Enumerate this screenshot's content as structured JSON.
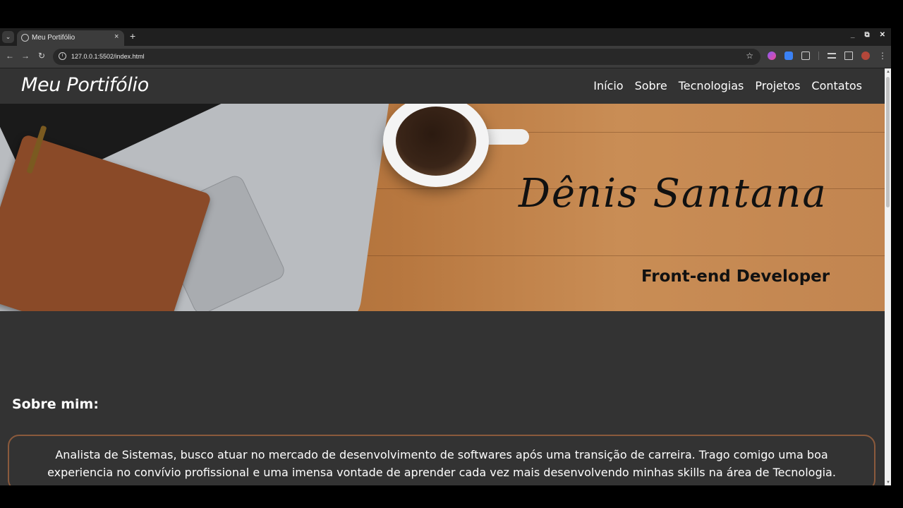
{
  "browser": {
    "tab_title": "Meu Portifólio",
    "tab_close": "×",
    "new_tab": "+",
    "url": "127.0.0.1:5502/index.html",
    "controls": {
      "minimize": "_",
      "restore": "⧉",
      "close": "✕"
    }
  },
  "site": {
    "logo": "Meu Portifólio",
    "nav": [
      "Início",
      "Sobre",
      "Tecnologias",
      "Projetos",
      "Contatos"
    ]
  },
  "hero": {
    "signature": "Dênis Santana",
    "subtitle": "Front-end Developer"
  },
  "about": {
    "title": "Sobre mim:",
    "text": "Analista de Sistemas, busco atuar no mercado de desenvolvimento de softwares após uma transição de carreira. Trago comigo uma boa experiencia no convívio profissional e uma imensa vontade de aprender cada vez mais desenvolvendo minhas skills na área de Tecnologia."
  },
  "icons": {
    "tab_search": "chevron-down-icon",
    "back": "back-arrow-icon",
    "forward": "forward-arrow-icon",
    "reload": "reload-icon",
    "site_info": "info-icon",
    "bookmark": "star-icon"
  },
  "colors": {
    "page_bg": "#333333",
    "about_border": "#8b5a3c",
    "toolbar_bg": "#3c3c3c"
  }
}
